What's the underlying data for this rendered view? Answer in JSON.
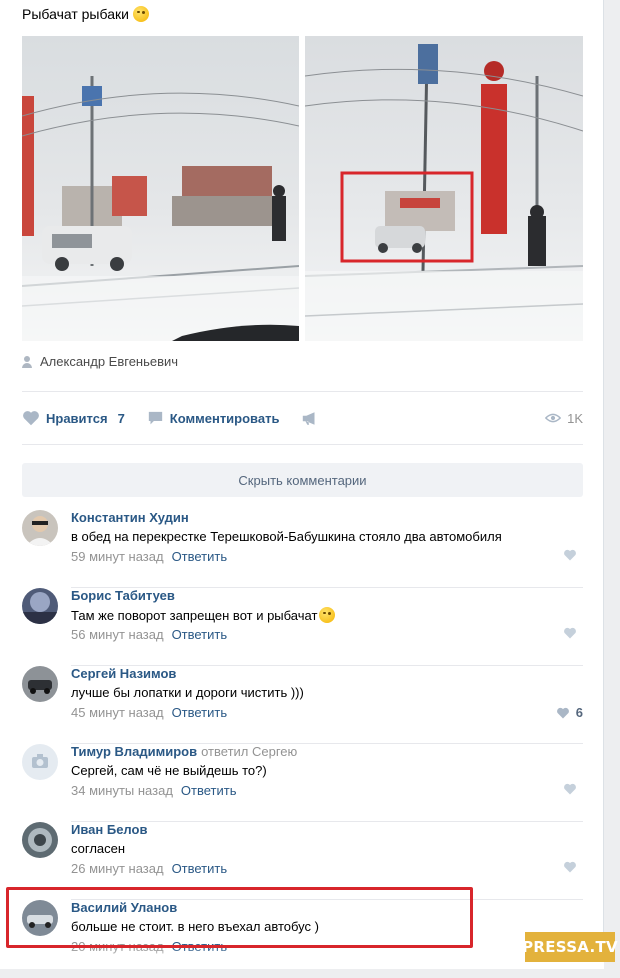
{
  "post": {
    "text": "Рыбачат рыбаки",
    "emoji": "winking-face-icon",
    "author": "Александр Евгеньевич"
  },
  "actions": {
    "like_label": "Нравится",
    "like_count": "7",
    "comment_label": "Комментировать",
    "views": "1K"
  },
  "comments_toggle": "Скрыть комментарии",
  "comments": [
    {
      "name": "Константин Худин",
      "replied": "",
      "text": "в обед на перекрестке Терешковой-Бабушкина стояло два автомобиля",
      "time": "59 минут назад",
      "reply_label": "Ответить",
      "likes": ""
    },
    {
      "name": "Борис Табитуев",
      "replied": "",
      "text": "Там же поворот запрещен вот и рыбачат",
      "time": "56 минут назад",
      "reply_label": "Ответить",
      "likes": ""
    },
    {
      "name": "Сергей Назимов",
      "replied": "",
      "text": "лучше бы лопатки и дороги чистить )))",
      "time": "45 минут назад",
      "reply_label": "Ответить",
      "likes": "6"
    },
    {
      "name": "Тимур Владимиров",
      "replied": "ответил Сергею",
      "text": "Сергей, сам чё не выйдешь то?)",
      "time": "34 минуты назад",
      "reply_label": "Ответить",
      "likes": ""
    },
    {
      "name": "Иван Белов",
      "replied": "",
      "text": "согласен",
      "time": "26 минут назад",
      "reply_label": "Ответить",
      "likes": ""
    },
    {
      "name": "Василий Уланов",
      "replied": "",
      "text": "больше не стоит. в него въехал автобус )",
      "time": "20 минут назад",
      "reply_label": "Ответить",
      "likes": ""
    }
  ],
  "watermark": "PRESSA.TV",
  "colors": {
    "link": "#2a5885",
    "meta": "#939393",
    "highlight": "#d8262b",
    "watermark": "#e3b23c"
  }
}
